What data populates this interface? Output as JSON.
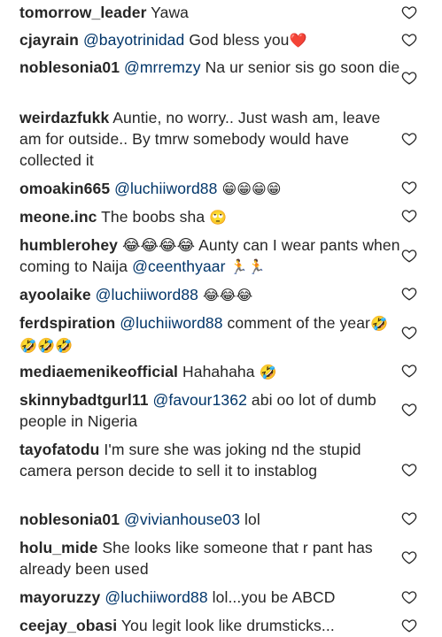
{
  "comments": [
    {
      "user": "tomorrow_leader",
      "mention": "",
      "text": "Yawa",
      "emoji": ""
    },
    {
      "user": "cjayrain",
      "mention": "@bayotrinidad",
      "text": "God bless you",
      "emoji": "❤️"
    },
    {
      "user": "noblesonia01",
      "mention": "@mrremzy",
      "text": "Na ur senior sis go soon die",
      "emoji": ""
    },
    {
      "user": "weirdazfukk",
      "mention": "",
      "text": "Auntie, no worry.. Just wash am, leave am for outside.. By tmrw somebody would have collected it",
      "emoji": ""
    },
    {
      "user": "omoakin665",
      "mention": "@luchiiword88",
      "text": "",
      "emoji": "😁😁😁😁"
    },
    {
      "user": "meone.inc",
      "mention": "",
      "text": "The boobs sha",
      "emoji": "🙄"
    },
    {
      "user": "humblerohey",
      "mention": "",
      "text": "😂😂😂😂 Aunty can I wear pants when coming to Naija",
      "mention2": "@ceenthyaar",
      "emoji": "🏃🏃"
    },
    {
      "user": "ayoolaike",
      "mention": "@luchiiword88",
      "text": "",
      "emoji": "😂😂😂"
    },
    {
      "user": "ferdspiration",
      "mention": "@luchiiword88",
      "text": "comment of the year",
      "emoji": "🤣🤣🤣🤣"
    },
    {
      "user": "mediaemenikeofficial",
      "mention": "",
      "text": "Hahahaha",
      "emoji": "🤣"
    },
    {
      "user": "skinnybadtgurl11",
      "mention": "@favour1362",
      "text": "abi oo lot of dumb people in Nigeria",
      "emoji": ""
    },
    {
      "user": "tayofatodu",
      "mention": "",
      "text": "I'm sure she was joking nd the stupid camera person decide to sell it to instablog",
      "emoji": ""
    },
    {
      "user": "noblesonia01",
      "mention": "@vivianhouse03",
      "text": "lol",
      "emoji": ""
    },
    {
      "user": "holu_mide",
      "mention": "",
      "text": "She looks like someone that r pant has already been used",
      "emoji": ""
    },
    {
      "user": "mayoruzzy",
      "mention": "@luchiiword88",
      "text": "lol...you be ABCD",
      "emoji": ""
    },
    {
      "user": "ceejay_obasi",
      "mention": "",
      "text": "You legit look like drumsticks...",
      "emoji": ""
    }
  ],
  "colors": {
    "text": "#262626",
    "mention": "#003569",
    "heart_outline": "#262626"
  },
  "icons": {
    "like": "heart-outline-icon"
  }
}
